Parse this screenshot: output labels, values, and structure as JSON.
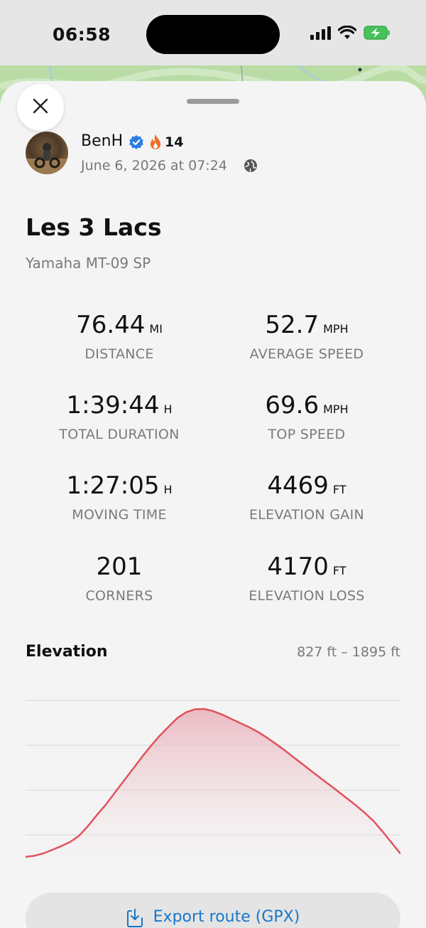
{
  "status_bar": {
    "time": "06:58"
  },
  "user": {
    "name": "BenH",
    "streak": "14",
    "date": "June 6, 2026 at 07:24"
  },
  "ride": {
    "title": "Les 3 Lacs",
    "bike": "Yamaha MT-09 SP"
  },
  "stats": [
    {
      "value": "76.44",
      "unit": "MI",
      "label": "DISTANCE"
    },
    {
      "value": "52.7",
      "unit": "MPH",
      "label": "AVERAGE SPEED"
    },
    {
      "value": "1:39:44",
      "unit": "H",
      "label": "TOTAL DURATION"
    },
    {
      "value": "69.6",
      "unit": "MPH",
      "label": "TOP SPEED"
    },
    {
      "value": "1:27:05",
      "unit": "H",
      "label": "MOVING TIME"
    },
    {
      "value": "4469",
      "unit": "FT",
      "label": "ELEVATION GAIN"
    },
    {
      "value": "201",
      "unit": "",
      "label": "CORNERS"
    },
    {
      "value": "4170",
      "unit": "FT",
      "label": "ELEVATION LOSS"
    }
  ],
  "elevation": {
    "title": "Elevation",
    "range": "827 ft – 1895 ft"
  },
  "export": {
    "label": "Export route (GPX)"
  },
  "chart_data": {
    "type": "area",
    "title": "Elevation",
    "xlabel": "",
    "ylabel": "",
    "ylim": [
      827,
      1895
    ],
    "series": [
      {
        "values": [
          827,
          835,
          852,
          878,
          905,
          935,
          980,
          1050,
          1130,
          1205,
          1290,
          1375,
          1460,
          1545,
          1625,
          1700,
          1765,
          1830,
          1872,
          1893,
          1895,
          1880,
          1855,
          1825,
          1795,
          1765,
          1730,
          1690,
          1645,
          1598,
          1548,
          1498,
          1448,
          1398,
          1350,
          1300,
          1250,
          1200,
          1145,
          1085,
          1010,
          930,
          850
        ]
      }
    ],
    "colors": {
      "line": "#e0525e",
      "fill": "#f2c6cc"
    },
    "grid": true
  }
}
